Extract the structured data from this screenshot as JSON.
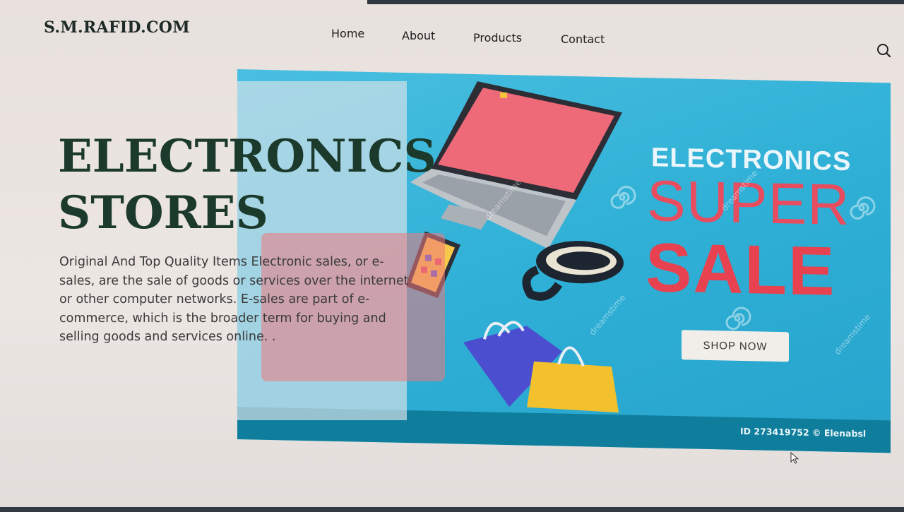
{
  "header": {
    "logo": "S.M.RAFID.COM",
    "nav": [
      "Home",
      "About",
      "Products",
      "Contact"
    ],
    "search_icon": "search-icon"
  },
  "hero": {
    "title_line1": "ELECTRONICS",
    "title_line2": "STORES",
    "description": "Original And Top Quality Items Electronic sales, or e-sales, are the sale of goods or services over the internet or other computer networks. E-sales are part of e-commerce, which is the broader term for buying and selling goods and services online. ."
  },
  "banner": {
    "heading": "ELECTRONICS",
    "super": "SUPER",
    "sale": "SALE",
    "button": "SHOP NOW",
    "watermark": "dreamstime",
    "credit": "ID 273419752 © Elenabsl",
    "colors": {
      "background": "#2fb0d6",
      "sale_red": "#e8414f",
      "footer": "#0f7e9c"
    }
  }
}
